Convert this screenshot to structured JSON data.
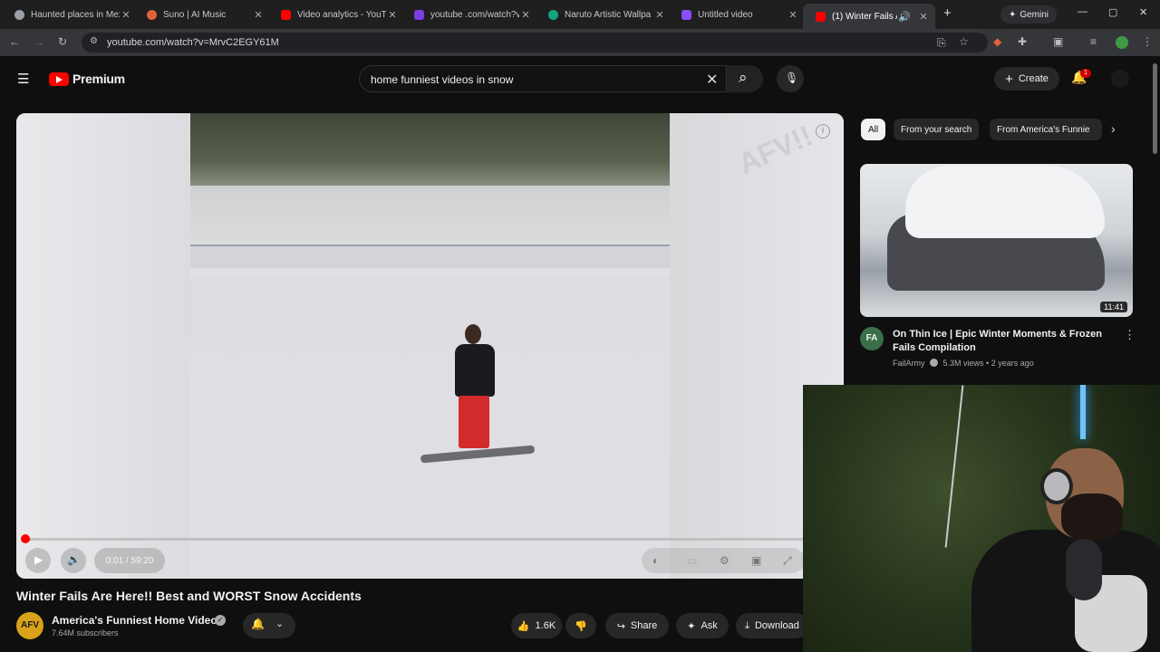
{
  "browser": {
    "tabs": [
      {
        "title": "Haunted places in Mex",
        "color": "#9aa0a6"
      },
      {
        "title": "Suno | AI Music",
        "color": "#e0623a"
      },
      {
        "title": "Video analytics - YouTu",
        "color": "#ff0000"
      },
      {
        "title": "youtube .com/watch?v",
        "color": "#7b3fe4"
      },
      {
        "title": "Naruto Artistic Wallpa",
        "color": "#16a37f"
      },
      {
        "title": "Untitled video",
        "color": "#8a4dff"
      },
      {
        "title": "(1) Winter Fails Are",
        "color": "#ff0000"
      }
    ],
    "new_tab": "+",
    "gemini_label": "Gemini",
    "url": "youtube.com/watch?v=MrvC2EGY61M"
  },
  "youtube": {
    "logo_text": "Premium",
    "search_value": "home funniest videos in snow",
    "create_label": "Create",
    "notification_count": "1"
  },
  "player": {
    "time": "0:01 / 59:20",
    "progress": 0.0003,
    "watermark": "AFV!!"
  },
  "video": {
    "title": "Winter Fails Are Here!! Best and WORST Snow Accidents",
    "channel": "America's Funniest Home Videos",
    "channel_avatar": "AFV",
    "subscribers": "7.64M subscribers",
    "likes": "1.6K",
    "share_label": "Share",
    "ask_label": "Ask",
    "download_label": "Download"
  },
  "chips": [
    "All",
    "From your search",
    "From America's Funnie"
  ],
  "recommendation": {
    "duration": "11:41",
    "title": "On Thin Ice | Epic Winter Moments & Frozen Fails Compilation",
    "channel": "FailArmy",
    "channel_avatar": "FA",
    "meta": "5.3M views • 2 years ago"
  },
  "icons": {
    "menu": "☰",
    "back": "←",
    "forward": "→",
    "reload": "↻",
    "search": "⌕",
    "mic": "🎙",
    "bell": "🔔",
    "close": "✕",
    "play": "▶",
    "volume": "🔊",
    "like": "👍",
    "dislike": "👎",
    "share": "↪",
    "ask": "✦",
    "download": "⤓",
    "more": "⋮",
    "next": "›",
    "verified": "✓",
    "info": "i",
    "plus": "+"
  }
}
